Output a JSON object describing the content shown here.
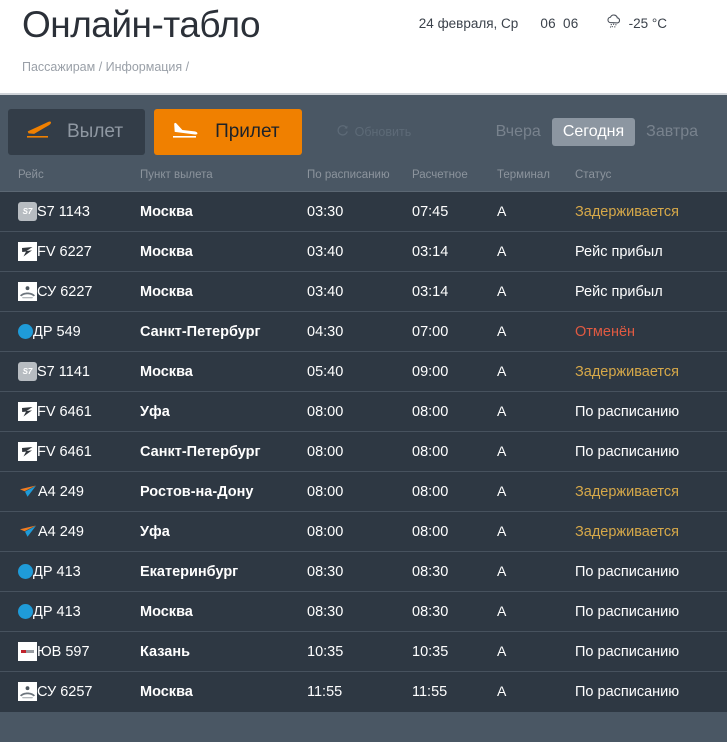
{
  "header": {
    "title": "Онлайн-табло",
    "date": "24 февраля, Ср",
    "clock_hours": "06",
    "clock_separator": " ",
    "clock_minutes": "06",
    "weather_icon": "snow-cloud-icon",
    "temperature": "-25 °C",
    "breadcrumb": "Пассажирам / Информация /"
  },
  "controls": {
    "tab_departure": "Вылет",
    "tab_arrival": "Прилет",
    "departure_icon": "plane-takeoff-icon",
    "arrival_icon": "plane-landing-icon",
    "refresh_label": "Обновить",
    "refresh_icon": "refresh-icon",
    "day_yesterday": "Вчера",
    "day_today": "Сегодня",
    "day_tomorrow": "Завтра",
    "active_tab": "Прилет",
    "active_day": "Сегодня"
  },
  "colors": {
    "accent_orange": "#f08000",
    "panel_bg": "#4a5764",
    "row_bg": "#2e3843",
    "status_delayed": "#d6a849",
    "status_cancelled": "#e05a42",
    "logo_blue": "#1f9bd8"
  },
  "table": {
    "headers": {
      "flight": "Рейс",
      "origin": "Пункт вылета",
      "scheduled": "По расписанию",
      "estimated": "Расчетное",
      "terminal": "Терминал",
      "status": "Статус"
    },
    "rows": [
      {
        "logo": "s7",
        "flight": "S7 1143",
        "origin": "Москва",
        "scheduled": "03:30",
        "estimated": "07:45",
        "terminal": "A",
        "status": "Задерживается",
        "status_kind": "delayed"
      },
      {
        "logo": "fv",
        "flight": "FV 6227",
        "origin": "Москва",
        "scheduled": "03:40",
        "estimated": "03:14",
        "terminal": "A",
        "status": "Рейс прибыл",
        "status_kind": "arrived"
      },
      {
        "logo": "su",
        "flight": "СУ 6227",
        "origin": "Москва",
        "scheduled": "03:40",
        "estimated": "03:14",
        "terminal": "A",
        "status": "Рейс прибыл",
        "status_kind": "arrived"
      },
      {
        "logo": "dp",
        "flight": "ДР 549",
        "origin": "Санкт-Петербург",
        "scheduled": "04:30",
        "estimated": "07:00",
        "terminal": "A",
        "status": "Отменён",
        "status_kind": "cancelled"
      },
      {
        "logo": "s7",
        "flight": "S7 1141",
        "origin": "Москва",
        "scheduled": "05:40",
        "estimated": "09:00",
        "terminal": "A",
        "status": "Задерживается",
        "status_kind": "delayed"
      },
      {
        "logo": "fv",
        "flight": "FV 6461",
        "origin": "Уфа",
        "scheduled": "08:00",
        "estimated": "08:00",
        "terminal": "A",
        "status": "По расписанию",
        "status_kind": "ontime"
      },
      {
        "logo": "fv",
        "flight": "FV 6461",
        "origin": "Санкт-Петербург",
        "scheduled": "08:00",
        "estimated": "08:00",
        "terminal": "A",
        "status": "По расписанию",
        "status_kind": "ontime"
      },
      {
        "logo": "a4",
        "flight": "A4 249",
        "origin": "Ростов-на-Дону",
        "scheduled": "08:00",
        "estimated": "08:00",
        "terminal": "A",
        "status": "Задерживается",
        "status_kind": "delayed"
      },
      {
        "logo": "a4",
        "flight": "A4 249",
        "origin": "Уфа",
        "scheduled": "08:00",
        "estimated": "08:00",
        "terminal": "A",
        "status": "Задерживается",
        "status_kind": "delayed"
      },
      {
        "logo": "dp",
        "flight": "ДР 413",
        "origin": "Екатеринбург",
        "scheduled": "08:30",
        "estimated": "08:30",
        "terminal": "A",
        "status": "По расписанию",
        "status_kind": "ontime"
      },
      {
        "logo": "dp",
        "flight": "ДР 413",
        "origin": "Москва",
        "scheduled": "08:30",
        "estimated": "08:30",
        "terminal": "A",
        "status": "По расписанию",
        "status_kind": "ontime"
      },
      {
        "logo": "uv",
        "flight": "ЮВ 597",
        "origin": "Казань",
        "scheduled": "10:35",
        "estimated": "10:35",
        "terminal": "A",
        "status": "По расписанию",
        "status_kind": "ontime"
      },
      {
        "logo": "su",
        "flight": "СУ 6257",
        "origin": "Москва",
        "scheduled": "11:55",
        "estimated": "11:55",
        "terminal": "A",
        "status": "По расписанию",
        "status_kind": "ontime"
      }
    ]
  }
}
